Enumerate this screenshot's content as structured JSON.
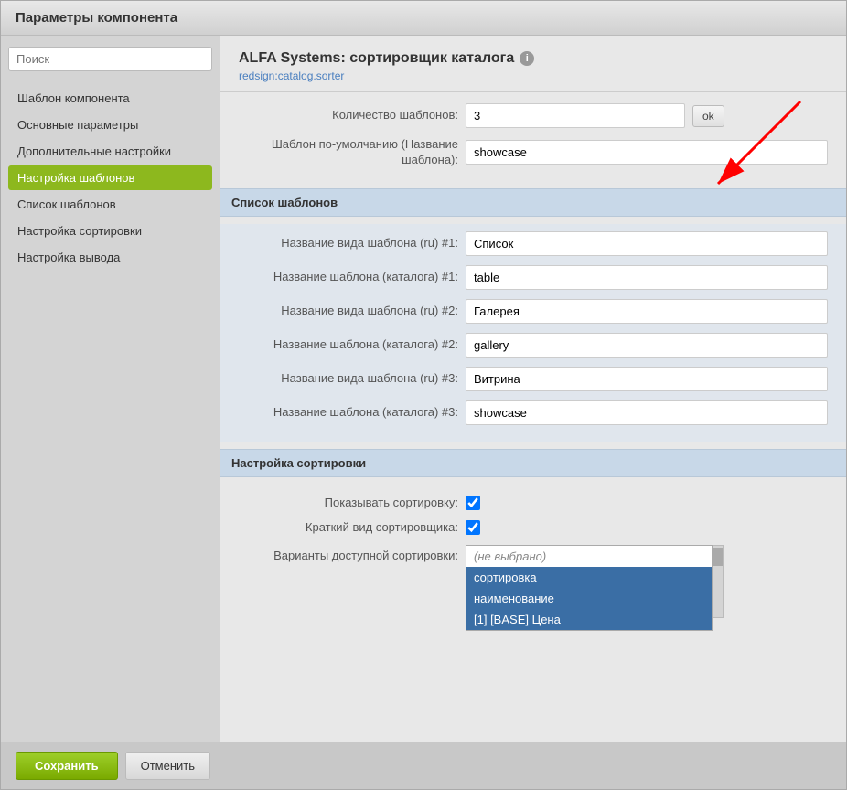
{
  "window": {
    "title": "Параметры компонента"
  },
  "sidebar": {
    "search_placeholder": "Поиск",
    "items": [
      {
        "id": "template",
        "label": "Шаблон компонента",
        "active": false
      },
      {
        "id": "basic",
        "label": "Основные параметры",
        "active": false
      },
      {
        "id": "advanced",
        "label": "Дополнительные настройки",
        "active": false
      },
      {
        "id": "template-settings",
        "label": "Настройка шаблонов",
        "active": true
      },
      {
        "id": "template-list",
        "label": "Список шаблонов",
        "active": false
      },
      {
        "id": "sort-settings",
        "label": "Настройка сортировки",
        "active": false
      },
      {
        "id": "output-settings",
        "label": "Настройка вывода",
        "active": false
      }
    ]
  },
  "content": {
    "title": "ALFA Systems: сортировщик каталога",
    "subtitle": "redsign:catalog.sorter",
    "info_icon": "i",
    "form": {
      "template_count_label": "Количество шаблонов:",
      "template_count_value": "3",
      "ok_label": "ok",
      "default_template_label": "Шаблон по-умолчанию (Название шаблона):",
      "default_template_value": "showcase"
    },
    "section_templates": {
      "header": "Список шаблонов",
      "fields": [
        {
          "label": "Название вида шаблона (ru) #1:",
          "value": "Список"
        },
        {
          "label": "Название шаблона (каталога) #1:",
          "value": "table"
        },
        {
          "label": "Название вида шаблона (ru) #2:",
          "value": "Галерея"
        },
        {
          "label": "Название шаблона (каталога) #2:",
          "value": "gallery"
        },
        {
          "label": "Название вида шаблона (ru) #3:",
          "value": "Витрина"
        },
        {
          "label": "Название шаблона (каталога) #3:",
          "value": "showcase"
        }
      ]
    },
    "section_sorting": {
      "header": "Настройка сортировки",
      "show_sorting_label": "Показывать сортировку:",
      "show_sorting_checked": true,
      "brief_view_label": "Краткий вид сортировщика:",
      "brief_view_checked": true,
      "variants_label": "Варианты доступной сортировки:",
      "dropdown": {
        "items": [
          {
            "label": "(не выбрано)",
            "type": "placeholder"
          },
          {
            "label": "сортировка",
            "type": "selected"
          },
          {
            "label": "наименование",
            "type": "selected"
          },
          {
            "label": "[1] [BASE] Цена",
            "type": "selected"
          }
        ]
      }
    }
  },
  "footer": {
    "save_label": "Сохранить",
    "cancel_label": "Отменить"
  }
}
